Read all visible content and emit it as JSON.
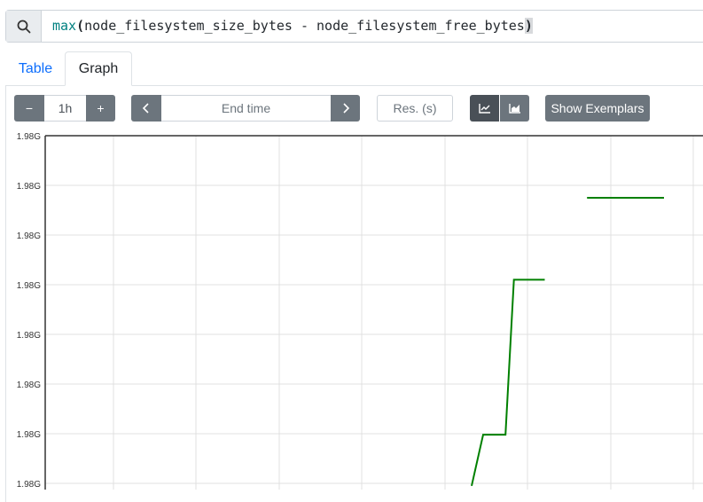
{
  "expression": {
    "fn": "max",
    "open_paren": "(",
    "inner": "node_filesystem_size_bytes - node_filesystem_free_bytes",
    "close_paren": ")"
  },
  "tabs": [
    {
      "label": "Table",
      "active": false
    },
    {
      "label": "Graph",
      "active": true
    }
  ],
  "controls": {
    "range_minus": "−",
    "range_value": "1h",
    "range_plus": "+",
    "end_time_placeholder": "End time",
    "resolution_placeholder": "Res. (s)",
    "show_exemplars_label": "Show Exemplars"
  },
  "icons": {
    "search": "search-icon",
    "chevron_left": "chevron-left-icon",
    "chevron_right": "chevron-right-icon",
    "line_chart": "line-chart-icon",
    "stacked_chart": "area-chart-icon"
  },
  "colors": {
    "series": "#008000",
    "button": "#6c757d",
    "active_button": "#495057",
    "link": "#0d6efd"
  },
  "chart_data": {
    "type": "line",
    "y_tick_labels": [
      "1.98G",
      "1.98G",
      "1.98G",
      "1.98G",
      "1.98G",
      "1.98G",
      "1.98G",
      "1.98G"
    ],
    "ylim": [
      0,
      7
    ],
    "grid": true,
    "series": [
      {
        "color": "#008000",
        "segments": [
          [
            [
              0.0,
              -0.05
            ],
            [
              0.06,
              0.98
            ],
            [
              0.09,
              0.98
            ],
            [
              0.09,
              0.98
            ],
            [
              0.176,
              0.98
            ],
            [
              0.22,
              4.1
            ],
            [
              0.38,
              4.1
            ]
          ],
          [
            [
              0.6,
              5.75
            ],
            [
              1.0,
              5.75
            ]
          ]
        ]
      }
    ]
  }
}
